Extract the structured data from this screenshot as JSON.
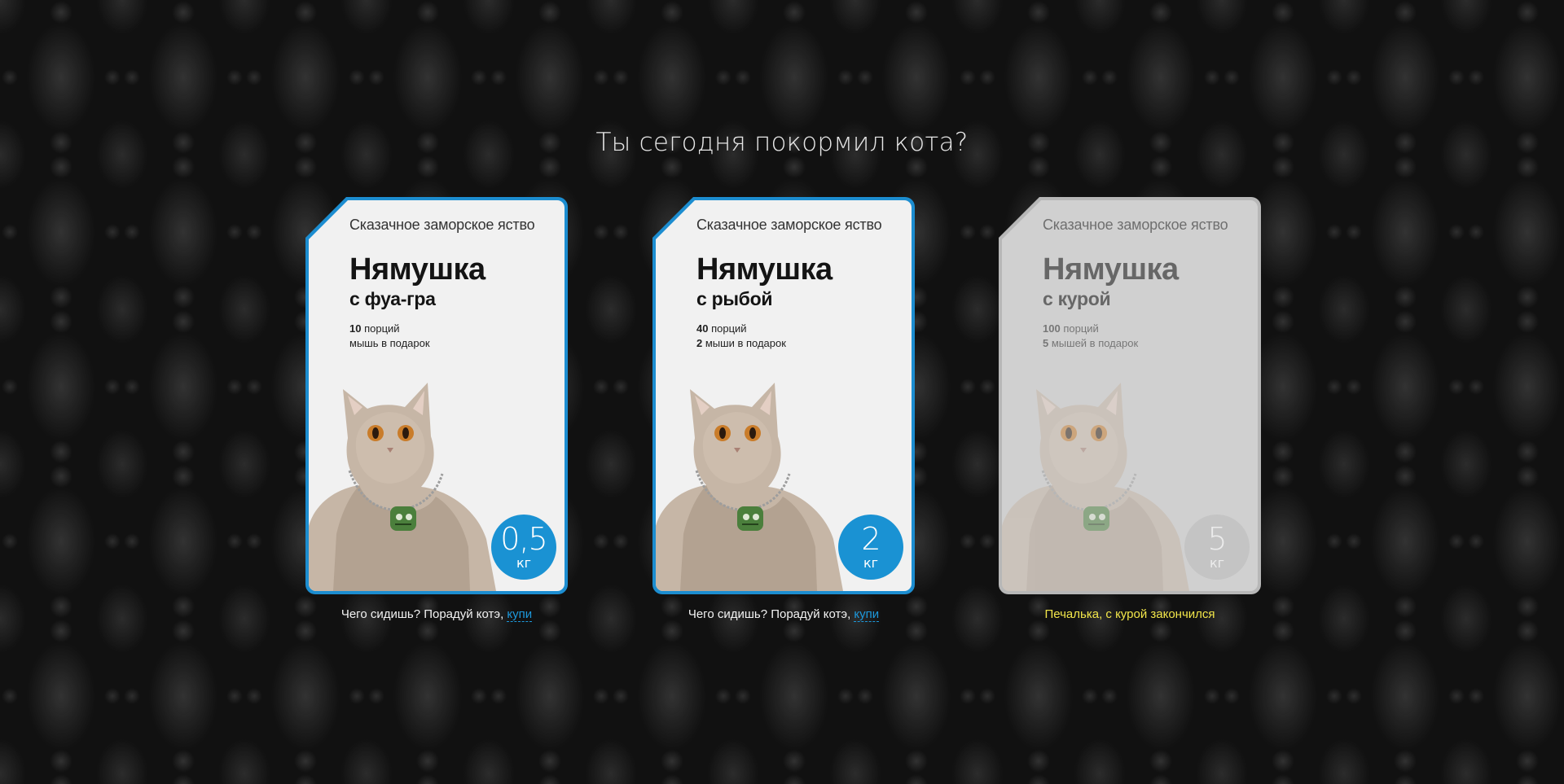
{
  "page": {
    "title": "Ты сегодня покормил кота?"
  },
  "colors": {
    "accent": "#1a92d3",
    "card_background": "#f1f1f1",
    "disabled_card": "#d0d0d0",
    "disabled_caption": "#f2e64a",
    "page_background": "#111111"
  },
  "products": [
    {
      "tagline": "Сказачное заморское яство",
      "brand": "Нямушка",
      "flavor": "с фуа-гра",
      "portions_count": "10",
      "portions_label": "порций",
      "gift_count": "",
      "gift_label": "мышь в подарок",
      "weight": "0,5",
      "unit": "кг",
      "image": "cat-icon",
      "state": "default",
      "caption_text": "Чего сидишь? Порадуй котэ,",
      "caption_link": "купи"
    },
    {
      "tagline": "Сказачное заморское яство",
      "brand": "Нямушка",
      "flavor": "с рыбой",
      "portions_count": "40",
      "portions_label": "порций",
      "gift_count": "2",
      "gift_label": "мыши в подарок",
      "weight": "2",
      "unit": "кг",
      "image": "cat-icon",
      "state": "default",
      "caption_text": "Чего сидишь? Порадуй котэ,",
      "caption_link": "купи"
    },
    {
      "tagline": "Сказачное заморское яство",
      "brand": "Нямушка",
      "flavor": "с курой",
      "portions_count": "100",
      "portions_label": "порций",
      "gift_count": "5",
      "gift_label": "мышей в подарок",
      "weight": "5",
      "unit": "кг",
      "image": "cat-icon",
      "state": "disabled",
      "caption_text": "Печалька, с курой закончился",
      "caption_link": ""
    }
  ]
}
